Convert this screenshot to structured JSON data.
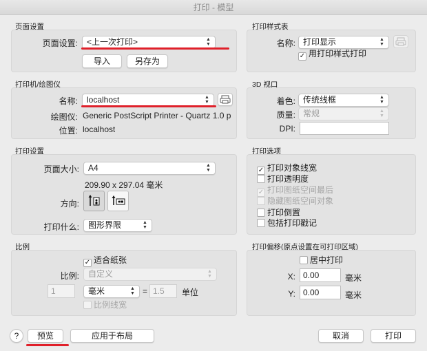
{
  "window": {
    "title": "打印 - 模型"
  },
  "page_setup": {
    "section": "页面设置",
    "label": "页面设置:",
    "value": "<上一次打印>",
    "import": "导入",
    "save_as": "另存为"
  },
  "plot_style": {
    "section": "打印样式表",
    "name_label": "名称:",
    "name_value": "打印显示",
    "use_style_label": "用打印样式打印",
    "use_style_checked": true
  },
  "printer": {
    "section": "打印机/绘图仪",
    "name_label": "名称:",
    "name_value": "localhost",
    "plotter_label": "绘图仪:",
    "plotter_value": "Generic PostScript Printer - Quartz 1.0 p",
    "location_label": "位置:",
    "location_value": "localhost"
  },
  "viewport_3d": {
    "section": "3D 视口",
    "shade_label": "着色:",
    "shade_value": "传统线框",
    "quality_label": "质量:",
    "quality_value": "常规",
    "dpi_label": "DPI:",
    "dpi_value": ""
  },
  "print_settings": {
    "section": "打印设置",
    "paper_size_label": "页面大小:",
    "paper_size_value": "A4",
    "paper_dims": "209.90 x 297.04 毫米",
    "orientation_label": "方向:",
    "what_label": "打印什么:",
    "what_value": "图形界限"
  },
  "print_options": {
    "section": "打印选项",
    "items": [
      {
        "label": "打印对象线宽",
        "checked": true,
        "disabled": false
      },
      {
        "label": "打印透明度",
        "checked": false,
        "disabled": false
      },
      {
        "label": "打印图纸空间最后",
        "checked": true,
        "disabled": true
      },
      {
        "label": "隐藏图纸空间对象",
        "checked": false,
        "disabled": true
      },
      {
        "label": "打印倒置",
        "checked": false,
        "disabled": false
      },
      {
        "label": "包括打印戳记",
        "checked": false,
        "disabled": false
      }
    ]
  },
  "scale": {
    "section": "比例",
    "fit_label": "适合纸张",
    "fit_checked": true,
    "scale_label": "比例:",
    "scale_value": "自定义",
    "left_value": "1",
    "unit_value": "毫米",
    "equals": "=",
    "right_value": "1.5",
    "unit_label": "单位",
    "lineweight_label": "比例线宽",
    "lineweight_checked": false
  },
  "offset": {
    "section": "打印偏移(原点设置在可打印区域)",
    "center_label": "居中打印",
    "center_checked": false,
    "x_label": "X:",
    "x_value": "0.00",
    "x_unit": "毫米",
    "y_label": "Y:",
    "y_value": "0.00",
    "y_unit": "毫米"
  },
  "footer": {
    "help": "?",
    "preview": "预览",
    "apply_layout": "应用于布局",
    "cancel": "取消",
    "print": "打印"
  },
  "accent_color": "#e0202a"
}
